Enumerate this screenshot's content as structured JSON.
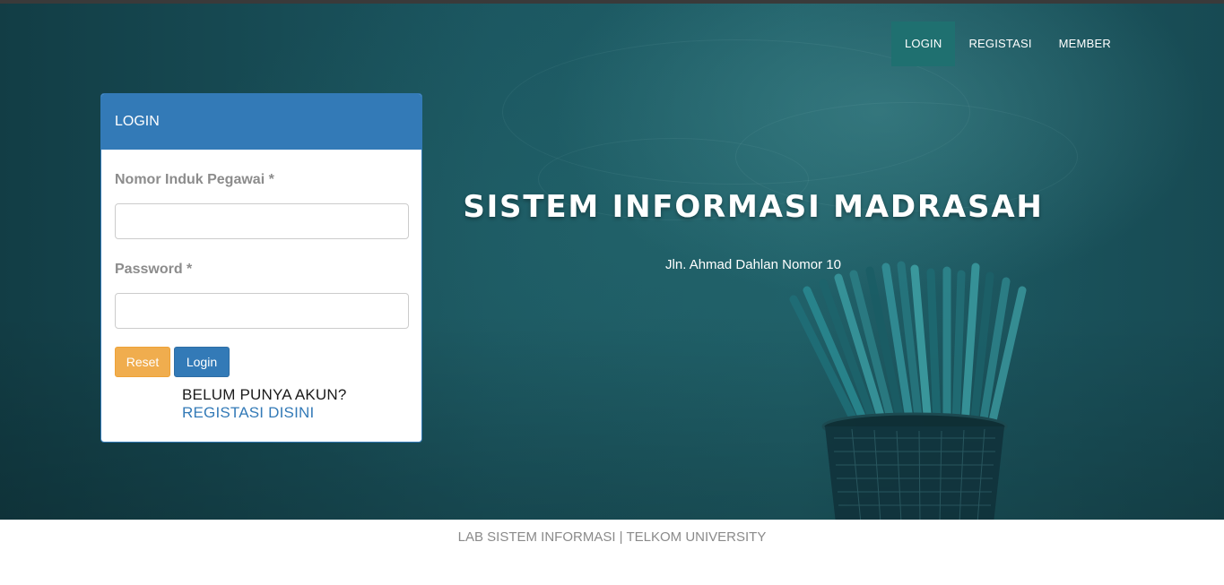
{
  "nav": {
    "items": [
      {
        "label": "LOGIN",
        "active": true
      },
      {
        "label": "REGISTASI",
        "active": false
      },
      {
        "label": "MEMBER",
        "active": false
      }
    ]
  },
  "hero": {
    "title": "SISTEM INFORMASI MADRASAH",
    "subtitle": "Jln. Ahmad Dahlan Nomor 10"
  },
  "login_panel": {
    "heading": "LOGIN",
    "nip_label": "Nomor Induk Pegawai *",
    "nip_value": "",
    "password_label": "Password *",
    "password_value": "",
    "reset_label": "Reset",
    "login_label": "Login",
    "signup_question": "BELUM PUNYA AKUN?",
    "signup_link": "REGISTASI DISINI"
  },
  "footer": {
    "text": "LAB SISTEM INFORMASI | TELKOM UNIVERSITY"
  },
  "colors": {
    "primary": "#337ab7",
    "warning": "#f0ad4e",
    "nav_active": "#1f7070",
    "hero_bg": "#1b5660"
  }
}
